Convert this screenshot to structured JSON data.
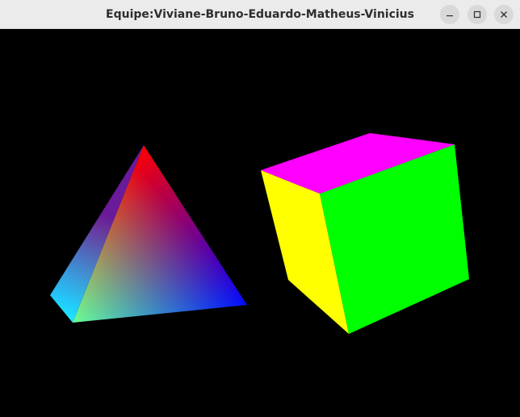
{
  "window": {
    "title": "Equipe:Viviane-Bruno-Eduardo-Matheus-Vinicius"
  },
  "controls": {
    "minimize_icon": "minimize-icon",
    "maximize_icon": "maximize-icon",
    "close_icon": "close-icon"
  },
  "scene": {
    "background": "#000000",
    "tetrahedron_colors": [
      "#ff0000",
      "#00ff00",
      "#0000ff"
    ],
    "cube_face_colors": {
      "top": "#ff00ff",
      "left": "#ffff00",
      "front": "#00ff00"
    }
  }
}
